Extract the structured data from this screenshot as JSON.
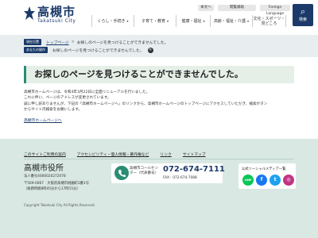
{
  "header": {
    "logo_main": "高槻市",
    "logo_sub": "Takatsuki City",
    "util": [
      "本文へ",
      "閲覧補助",
      "Foreign Language"
    ],
    "search_label": "検索",
    "nav": [
      "くらし・手続き",
      "子育て・教育",
      "健康・福祉",
      "高齢・福祉・介護",
      "文化・スポーツ・見どころ"
    ]
  },
  "breadcrumb": {
    "tag1": "現在位置",
    "home": "トップページ",
    "separator": ">",
    "current": "お探しのページを見つけることができませんでした。",
    "tag2": "あなたの操作",
    "line2": "お探しのページを見つけることができませんでした。",
    "close_glyph": "✕"
  },
  "main": {
    "heading": "お探しのページを見つけることができませんでした。",
    "lines": [
      "高槻市ホームページは、令和4年3月22日に全面リニューアルを行いました。",
      "これに伴い、ページのアドレスが変更されています。",
      "誠に申し訳ありませんが、下記の「高槻市ホームページへ」のリンクから、高槻市ホームページのトップページにアクセスしていただき、検索ボタン",
      "からサイト内検索をお願いします。"
    ],
    "link": "高槻市ホームページへ"
  },
  "footer": {
    "links": [
      "このサイトご利用の案内",
      "アクセシビリティ・個人情報・著作権など",
      "リンク",
      "サイトマップ"
    ],
    "city": "高槻市役所",
    "corp": "法人番号4000020272078",
    "address_lines": [
      "〒569-0067　大阪府高槻市桃園町2番1号",
      "（執務時間8時45分から17時15分）"
    ],
    "call_center": "高槻市コールセンター（代表番号）",
    "tel": "072-674-7111",
    "fax": "FAX：072-674-7088",
    "social_label": "公式ソーシャルメディア一覧",
    "social": [
      {
        "name": "line-icon",
        "glyph": "LINE",
        "color": "#06c755"
      },
      {
        "name": "facebook-icon",
        "glyph": "f",
        "color": "#1877f2"
      },
      {
        "name": "twitter-icon",
        "glyph": "t",
        "color": "#1da1f2"
      },
      {
        "name": "instagram-icon",
        "glyph": "◎",
        "color": "#c13584"
      }
    ],
    "copyright": "Copyright Takatsuki City All Rights Reserved."
  }
}
